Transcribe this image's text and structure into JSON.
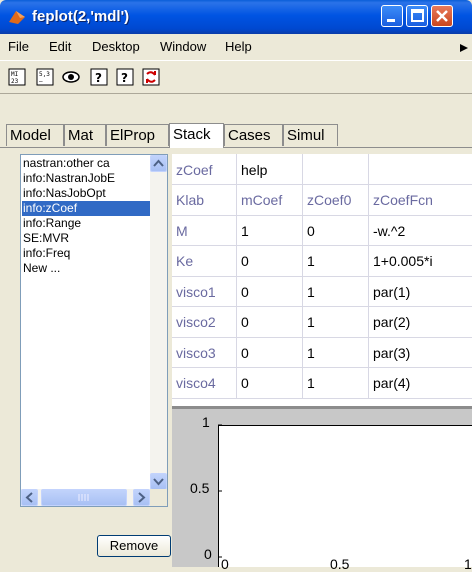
{
  "window": {
    "title": "feplot(2,'mdl')"
  },
  "menubar": {
    "items": [
      "File",
      "Edit",
      "Desktop",
      "Window",
      "Help"
    ]
  },
  "toolbar": {
    "icons": [
      "mesh-icon",
      "grid-icon",
      "eye-icon",
      "help-icon",
      "help-icon",
      "refresh-icon"
    ]
  },
  "tabs": [
    "Model",
    "Mat",
    "ElProp",
    "Stack",
    "Cases",
    "Simul"
  ],
  "active_tab": "Stack",
  "list": {
    "items": [
      "nastran:other ca",
      "info:NastranJobE",
      "info:NasJobOpt",
      "info:zCoef",
      "info:Range",
      "SE:MVR",
      "info:Freq",
      "New ..."
    ],
    "selected_index": 3
  },
  "remove_button": "Remove",
  "table": {
    "rows": [
      [
        "zCoef",
        "help",
        "",
        ""
      ],
      [
        "Klab",
        "mCoef",
        "zCoef0",
        "zCoefFcn"
      ],
      [
        "M",
        "1",
        "0",
        "-w.^2"
      ],
      [
        "Ke",
        "0",
        "1",
        "1+0.005*i"
      ],
      [
        "visco1",
        "0",
        "1",
        "par(1)"
      ],
      [
        "visco2",
        "0",
        "1",
        "par(2)"
      ],
      [
        "visco3",
        "0",
        "1",
        "par(3)"
      ],
      [
        "visco4",
        "0",
        "1",
        "par(4)"
      ]
    ]
  },
  "plot": {
    "y_ticks": [
      "1",
      "0.5",
      "0"
    ],
    "x_ticks": [
      "0",
      "0.5",
      "1"
    ]
  },
  "colors": {
    "title_bar": "#0054e3",
    "selection": "#316ac5",
    "header_text": "#6a6aa0"
  }
}
